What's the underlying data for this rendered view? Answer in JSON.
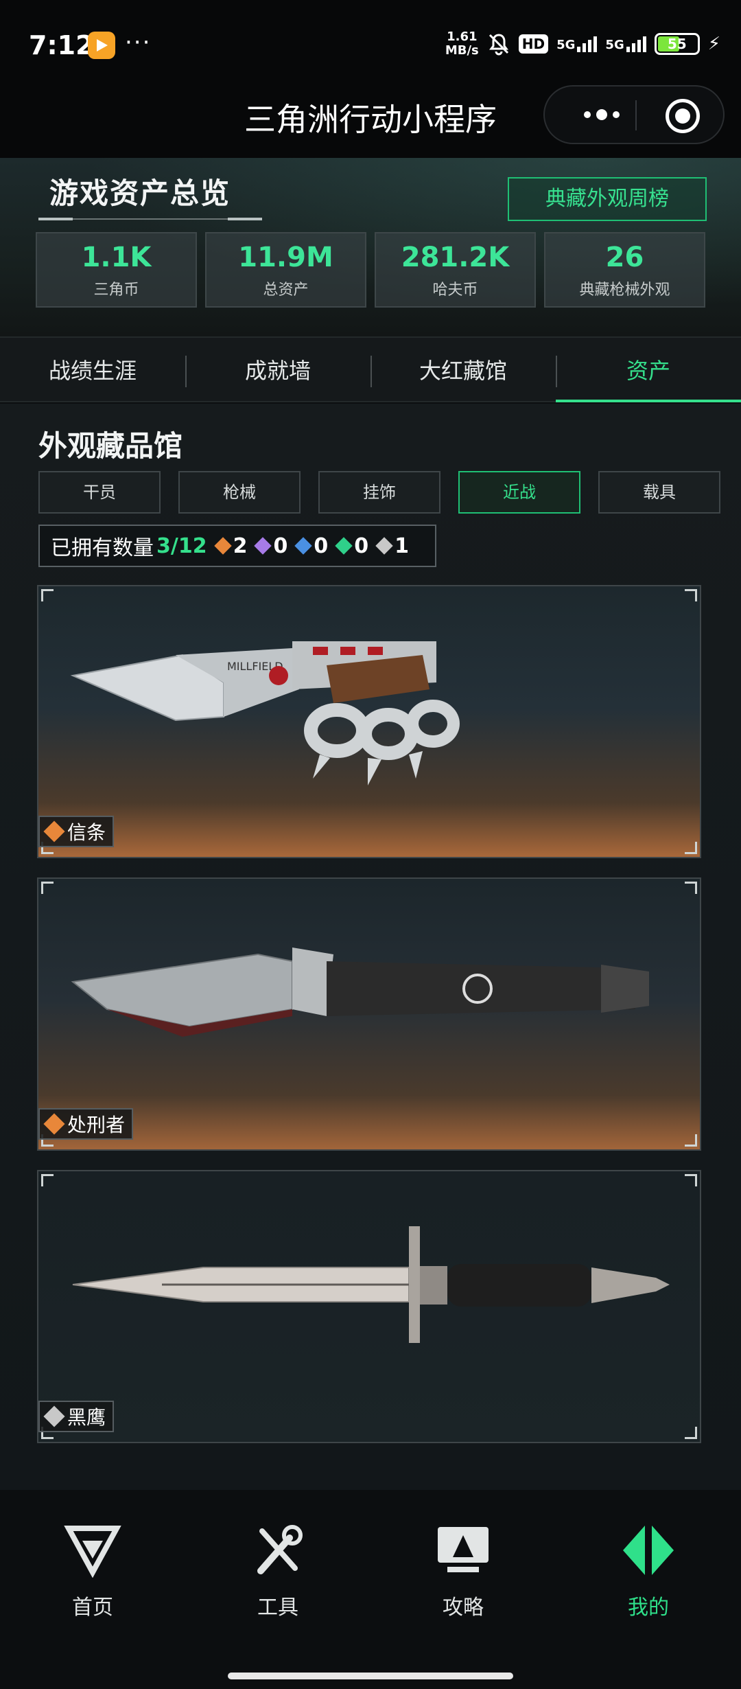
{
  "status_bar": {
    "time": "7:12",
    "more": "···",
    "speed_value": "1.61",
    "speed_unit": "MB/s",
    "hd": "HD",
    "signal1": "5G",
    "signal2": "5G",
    "battery": "55",
    "icons": [
      "bilibili-app-icon",
      "mute-bell-icon",
      "signal-icon",
      "battery-icon",
      "charging-icon"
    ]
  },
  "title_bar": {
    "title": "三角洲行动小程序",
    "icons": [
      "more-dots-icon",
      "close-target-icon"
    ]
  },
  "overview": {
    "title": "游戏资产总览",
    "weekly_button": "典藏外观周榜",
    "stats": [
      {
        "value": "1.1K",
        "label": "三角币"
      },
      {
        "value": "11.9M",
        "label": "总资产"
      },
      {
        "value": "281.2K",
        "label": "哈夫币"
      },
      {
        "value": "26",
        "label": "典藏枪械外观"
      }
    ]
  },
  "tabs": [
    {
      "label": "战绩生涯",
      "active": false
    },
    {
      "label": "成就墙",
      "active": false
    },
    {
      "label": "大红藏馆",
      "active": false
    },
    {
      "label": "资产",
      "active": true
    }
  ],
  "collection": {
    "title": "外观藏品馆",
    "filters": [
      {
        "label": "干员",
        "active": false
      },
      {
        "label": "枪械",
        "active": false
      },
      {
        "label": "挂饰",
        "active": false
      },
      {
        "label": "近战",
        "active": true
      },
      {
        "label": "载具",
        "active": false
      }
    ],
    "owned_label": "已拥有数量",
    "owned_count": "3/12",
    "rarity_counts": [
      {
        "color": "#e8873a",
        "count": "2"
      },
      {
        "color": "#a77be8",
        "count": "0"
      },
      {
        "color": "#4a90e2",
        "count": "0"
      },
      {
        "color": "#2fd08a",
        "count": "0"
      },
      {
        "color": "#c8c8c8",
        "count": "1"
      }
    ],
    "items": [
      {
        "name": "信条",
        "rarity_color": "#e8873a",
        "engraving": "MILLFIELD"
      },
      {
        "name": "处刑者",
        "rarity_color": "#e8873a",
        "engraving": ""
      },
      {
        "name": "黑鹰",
        "rarity_color": "#c8c8c8",
        "engraving": ""
      }
    ]
  },
  "bottom_nav": [
    {
      "label": "首页",
      "icon": "delta-logo-icon",
      "active": false
    },
    {
      "label": "工具",
      "icon": "wrench-screwdriver-icon",
      "active": false
    },
    {
      "label": "攻略",
      "icon": "monitor-guide-icon",
      "active": false
    },
    {
      "label": "我的",
      "icon": "profile-diamond-icon",
      "active": true
    }
  ],
  "colors": {
    "accent": "#35e08c",
    "background": "#12171a"
  }
}
